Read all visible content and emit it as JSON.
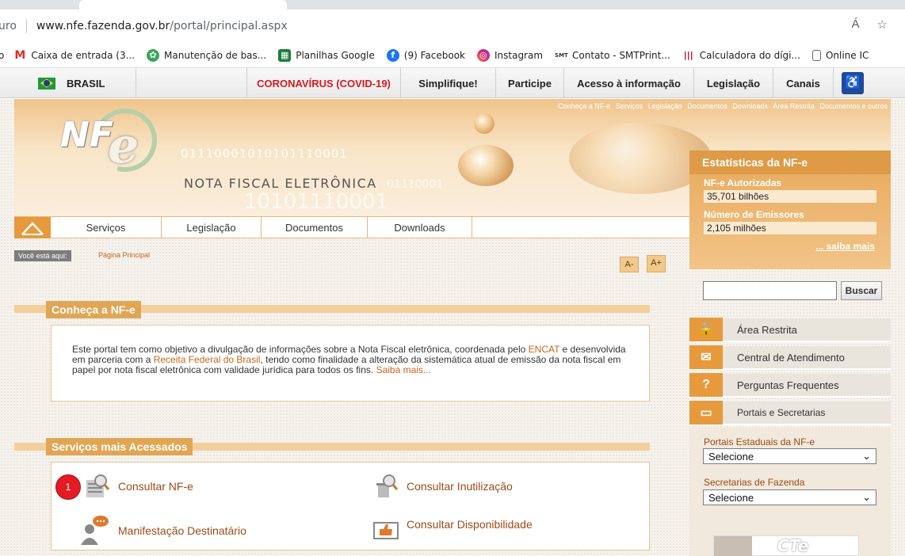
{
  "browser": {
    "address_prefix": "uro",
    "address_host": "www.nfe.fazenda.gov.br",
    "address_path": "/portal/principal.aspx",
    "read_aloud_icon": "Á",
    "favorites_icon": "☆"
  },
  "bookmarks": [
    {
      "icon": "gmail-icon",
      "label": "Caixa de entrada (3..."
    },
    {
      "icon": "puzzle-icon",
      "label": "Manutenção de bas..."
    },
    {
      "icon": "sheets-icon",
      "label": "Planilhas Google"
    },
    {
      "icon": "facebook-icon",
      "label": "(9) Facebook"
    },
    {
      "icon": "instagram-icon",
      "label": "Instagram"
    },
    {
      "icon": "smt-icon",
      "label": "Contato - SMTPrint..."
    },
    {
      "icon": "barcode-icon",
      "label": "Calculadora do dígi..."
    },
    {
      "icon": "page-icon",
      "label": "Online IC"
    }
  ],
  "govbar": {
    "brasil": "BRASIL",
    "covid": "CORONAVÍRUS (COVID-19)",
    "simplifique": "Simplifique!",
    "participe": "Participe",
    "acesso": "Acesso à informação",
    "legislacao": "Legislação",
    "canais": "Canais"
  },
  "banner": {
    "toplinks": [
      "Conheça a NF-e",
      "Serviços",
      "Legislação",
      "Documentos",
      "Downloads",
      "Área Restrita",
      "Documentos e outros"
    ],
    "logo_nf": "NF",
    "logo_e": "e",
    "title": "NOTA FISCAL ELETRÔNICA",
    "binary1": "01110001010101110001",
    "binary2": "10101110001",
    "binary3": "01110001"
  },
  "nav": {
    "items": [
      "Serviços",
      "Legislação",
      "Documentos",
      "Downloads"
    ]
  },
  "breadcrumb": {
    "label": "Você está aqui:",
    "current": "Página Principal"
  },
  "fontsize": {
    "decrease": "A-",
    "increase": "A+"
  },
  "intro": {
    "title": "Conheça a NF-e",
    "text_1": "Este portal tem como objetivo a divulgação de informações sobre a Nota Fiscal eletrônica, coordenada pelo ",
    "encat": "ENCAT",
    "text_2": " e desenvolvida em parceria com a ",
    "receita": "Receita Federal do Brasil",
    "text_3": ", tendo como finalidade a alteração da sistemática atual de emissão da nota fiscal em papel por nota fiscal eletrônica com validade jurídica para todos os fins. ",
    "saiba": "Saiba mais..."
  },
  "services": {
    "title": "Serviços mais Acessados",
    "consultar_nfe": "Consultar NF-e",
    "consultar_inutilizacao": "Consultar Inutilização",
    "manifestacao": "Manifestação Destinatário",
    "consultar_disponibilidade": "Consultar Disponibilidade"
  },
  "marker": {
    "number": "1"
  },
  "stats": {
    "title": "Estatísticas da NF-e",
    "autorizadas_label": "NF-e Autorizadas",
    "autorizadas_value": "35,701 bilhões",
    "emissores_label": "Número de Emissores",
    "emissores_value": "2,105 milhões",
    "saiba_mais": "... saiba mais"
  },
  "search": {
    "value": "",
    "button": "Buscar"
  },
  "sidebar": {
    "area_restrita": "Área Restrita",
    "central": "Central de Atendimento",
    "perguntas": "Perguntas Frequentes",
    "portais": "Portais e Secretarias",
    "portais_estaduais_label": "Portais Estaduais da NF-e",
    "portais_estaduais_value": "Selecione",
    "secretarias_label": "Secretarias de Fazenda",
    "secretarias_value": "Selecione",
    "cte_logo": "CTe"
  },
  "colors": {
    "accent": "#e79a3c",
    "link": "#c5651f",
    "covid": "#d71920",
    "marker": "#e31b23"
  }
}
